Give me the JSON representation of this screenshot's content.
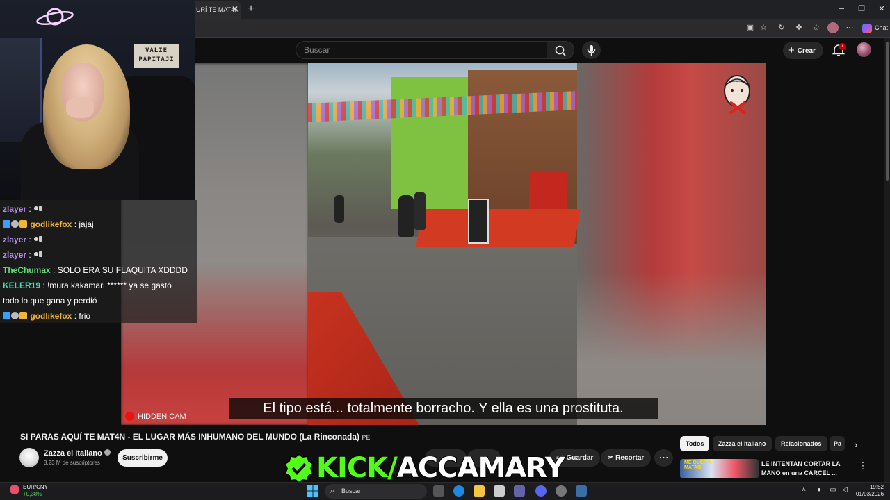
{
  "browser": {
    "tab_title": "URÍ TE MAT4N",
    "tab_close": "✕",
    "new_tab": "+",
    "window": {
      "minimize": "─",
      "restore": "❐",
      "close": "✕"
    },
    "toolbar_chat": "Chat"
  },
  "youtube": {
    "search_placeholder": "Buscar",
    "create_label": "Crear",
    "notification_count": "7",
    "video": {
      "subtitle": "El tipo está... totalmente borracho.  Y ella es una prostituta.",
      "hidden_cam_label": "HIDDEN CAM"
    },
    "title": "SI PARAS AQUÍ TE MAT4N - EL LUGAR MÁS INHUMANO DEL MUNDO (La Rinconada)",
    "title_suffix": "PE",
    "channel": {
      "name": "Zazza el Italiano",
      "subscribers": "3,23 M de suscriptores",
      "subscribe_label": "Suscribirme"
    },
    "actions": {
      "save_label": "Guardar",
      "clip_label": "Recortar",
      "more": "⋯"
    },
    "filters": [
      "Todos",
      "Zazza el Italiano",
      "Relacionados",
      "Pa"
    ],
    "recommendation": {
      "title_line1": "LE INTENTAN CORTAR LA",
      "title_line2": "MANO en una CARCEL ...",
      "thumb_text_line1": "ME QUERÍA",
      "thumb_text_line2": "MATAR"
    }
  },
  "stream": {
    "webcam_sign_line1": "VALIE",
    "webcam_sign_line2": "PAPITAJI",
    "kick_prefix": "KICK/",
    "kick_name": "ACCAMARY"
  },
  "chat": {
    "messages": [
      {
        "user": "zlayer",
        "text": " ",
        "color": "#b78cf2",
        "badges": false
      },
      {
        "user": "godlikefox",
        "text": "jajaj",
        "color": "#f2b632",
        "badges": true
      },
      {
        "user": "zlayer",
        "text": " ",
        "color": "#b78cf2",
        "badges": false
      },
      {
        "user": "zlayer",
        "text": " ",
        "color": "#b78cf2",
        "badges": false
      },
      {
        "user": "TheChumax",
        "text": "SOLO ERA SU FLAQUITA XDDDD",
        "color": "#5be07a",
        "badges": false
      },
      {
        "user": "KELER19",
        "text": "!mura kakamari ****** ya se gastó",
        "text2": "todo lo que gana y perdió",
        "color": "#40e0b0",
        "badges": false
      },
      {
        "user": "godlikefox",
        "text": "frio",
        "color": "#f2b632",
        "badges": true
      }
    ]
  },
  "taskbar": {
    "ticker_name": "EUR/CNY",
    "ticker_change": "+0,38%",
    "search_label": "Buscar",
    "time": "19:52",
    "date": "01/03/2026"
  },
  "colors": {
    "kick_green": "#53fc18",
    "youtube_bg": "#0f0f0f",
    "notification_red": "#cc0000"
  }
}
